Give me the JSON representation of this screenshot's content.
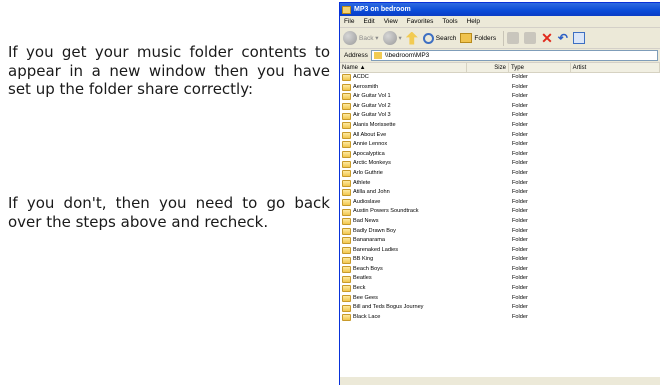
{
  "text": {
    "para1": "If you get your music folder contents to appear in a new window then you have set up the folder share correctly:",
    "para2": "If you don't, then you need to go back over the steps above and recheck."
  },
  "window": {
    "title": "MP3 on bedroom",
    "menu": [
      "File",
      "Edit",
      "View",
      "Favorites",
      "Tools",
      "Help"
    ],
    "toolbar": {
      "back": "Back",
      "search": "Search",
      "folders": "Folders"
    },
    "address_label": "Address",
    "address_value": "\\\\bedroom\\MP3",
    "columns": [
      "Name",
      "Size",
      "Type",
      "Artist"
    ],
    "files": [
      "ACDC",
      "Aerosmith",
      "Air Guitar Vol 1",
      "Air Guitar Vol 2",
      "Air Guitar Vol 3",
      "Alanis Morissette",
      "All About Eve",
      "Annie Lennox",
      "Apocalyptica",
      "Arctic Monkeys",
      "Arlo Guthrie",
      "Athlete",
      "Atilla and John",
      "Audioslave",
      "Austin Powers Soundtrack",
      "Bad News",
      "Badly Drawn Boy",
      "Bananarama",
      "Barenaked Ladies",
      "BB King",
      "Beach Boys",
      "Beatles",
      "Beck",
      "Bee Gees",
      "Bill and Teds Bogus Journey",
      "Black Lace"
    ],
    "file_type": "Folder"
  },
  "colors": {
    "titlebar": "#0a4bd8",
    "chrome": "#ece9d8",
    "delete": "#e02a1c"
  }
}
